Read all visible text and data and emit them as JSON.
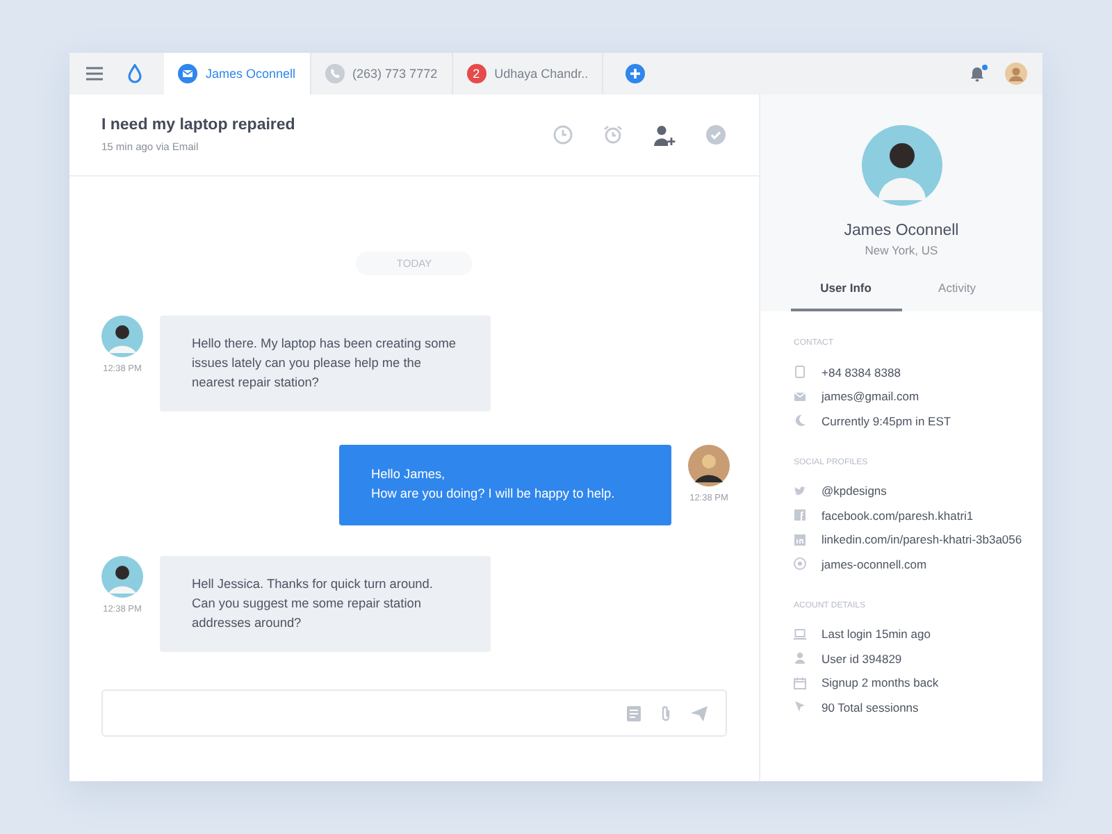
{
  "tabs": [
    {
      "kind": "email",
      "label": "James Oconnell",
      "selected": true
    },
    {
      "kind": "phone",
      "label": "(263) 773 7772",
      "selected": false
    },
    {
      "kind": "count",
      "count": "2",
      "label": "Udhaya Chandr..",
      "selected": false
    }
  ],
  "notifications": {
    "unread": true
  },
  "ticket": {
    "title": "I need my laptop repaired",
    "meta": "15 min ago via Email"
  },
  "day_divider": "TODAY",
  "messages": [
    {
      "kind": "incoming",
      "text": "Hello there. My laptop has been creating some issues lately can you please help me the nearest repair station?",
      "time": "12:38 PM"
    },
    {
      "kind": "outgoing",
      "text": "Hello James,\nHow are you doing? I will be happy to help.",
      "time": "12:38 PM"
    },
    {
      "kind": "incoming",
      "text": "Hell Jessica. Thanks for quick turn around. Can you suggest me some repair station addresses around?",
      "time": "12:38 PM"
    }
  ],
  "profile": {
    "name": "James Oconnell",
    "location": "New York, US"
  },
  "profile_tabs": [
    {
      "label": "User Info",
      "selected": true
    },
    {
      "label": "Activity",
      "selected": false
    }
  ],
  "sections": [
    {
      "title": "CONTACT",
      "items": [
        {
          "kind": "phone",
          "text": "+84 8384 8388"
        },
        {
          "kind": "mail",
          "text": "james@gmail.com"
        },
        {
          "kind": "moon",
          "text": "Currently 9:45pm in EST"
        }
      ]
    },
    {
      "title": "SOCIAL PROFILES",
      "items": [
        {
          "kind": "bird",
          "text": "@kpdesigns"
        },
        {
          "kind": "facebook",
          "text": "facebook.com/paresh.khatri1"
        },
        {
          "kind": "linkedin",
          "text": "linkedin.com/in/paresh-khatri-3b3a056"
        },
        {
          "kind": "globe",
          "text": "james-oconnell.com"
        }
      ]
    },
    {
      "title": "ACOUNT DETAILS",
      "items": [
        {
          "kind": "laptop",
          "text": "Last login 15min ago"
        },
        {
          "kind": "user",
          "text": "User id 394829"
        },
        {
          "kind": "calendar",
          "text": "Signup 2 months back"
        },
        {
          "kind": "cursor",
          "text": "90 Total sessionns"
        }
      ]
    }
  ]
}
